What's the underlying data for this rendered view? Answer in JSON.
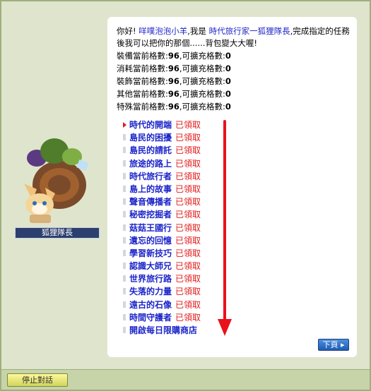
{
  "intro": {
    "greeting": "你好!",
    "player_name": "咩噗泡泡小羊",
    "middle": ",我是",
    "npc_title": "時代旅行家一狐狸隊長",
    "rest": ",完成指定的任務後我可以把你的那個......背包變大大喔!"
  },
  "capacity": [
    {
      "label": "裝備當前格數:",
      "current": "96",
      "expand_label": ",可擴充格數:",
      "expandable": "0"
    },
    {
      "label": "消耗當前格數:",
      "current": "96",
      "expand_label": ",可擴充格數:",
      "expandable": "0"
    },
    {
      "label": "裝飾當前格數:",
      "current": "96",
      "expand_label": ",可擴充格數:",
      "expandable": "0"
    },
    {
      "label": "其他當前格數:",
      "current": "96",
      "expand_label": ",可擴充格數:",
      "expandable": "0"
    },
    {
      "label": "特殊當前格數:",
      "current": "96",
      "expand_label": ",可擴充格數:",
      "expandable": "0"
    }
  ],
  "quests": [
    {
      "name": "時代的開端",
      "status": "已領取"
    },
    {
      "name": "島民的困擾",
      "status": "已領取"
    },
    {
      "name": "島民的請託",
      "status": "已領取"
    },
    {
      "name": "旅途的路上",
      "status": "已領取"
    },
    {
      "name": "時代旅行者",
      "status": "已領取"
    },
    {
      "name": "島上的故事",
      "status": "已領取"
    },
    {
      "name": "聲音傳播者",
      "status": "已領取"
    },
    {
      "name": "秘密挖掘者",
      "status": "已領取"
    },
    {
      "name": "菇菇王國行",
      "status": "已領取"
    },
    {
      "name": "遺忘的回憶",
      "status": "已領取"
    },
    {
      "name": "學習新技巧",
      "status": "已領取"
    },
    {
      "name": "認識大師兄",
      "status": "已領取"
    },
    {
      "name": "世界旅行路",
      "status": "已領取"
    },
    {
      "name": "失落的力量",
      "status": "已領取"
    },
    {
      "name": "遠古的石像",
      "status": "已領取"
    },
    {
      "name": "時間守護者",
      "status": "已領取"
    },
    {
      "name": "開啟每日限購商店",
      "status": ""
    }
  ],
  "npc_name": "狐狸隊長",
  "next_label": "下頁",
  "stop_label": "停止對話",
  "colors": {
    "link_blue": "#1c25c9",
    "claimed_red": "#e21b1b",
    "arrow_red": "#e8121b",
    "frame_green": "#dfe5cc"
  },
  "icons": [
    "selected-triangle-icon",
    "bullet-icon",
    "scroll-down-arrow-icon",
    "next-arrow-icon"
  ]
}
